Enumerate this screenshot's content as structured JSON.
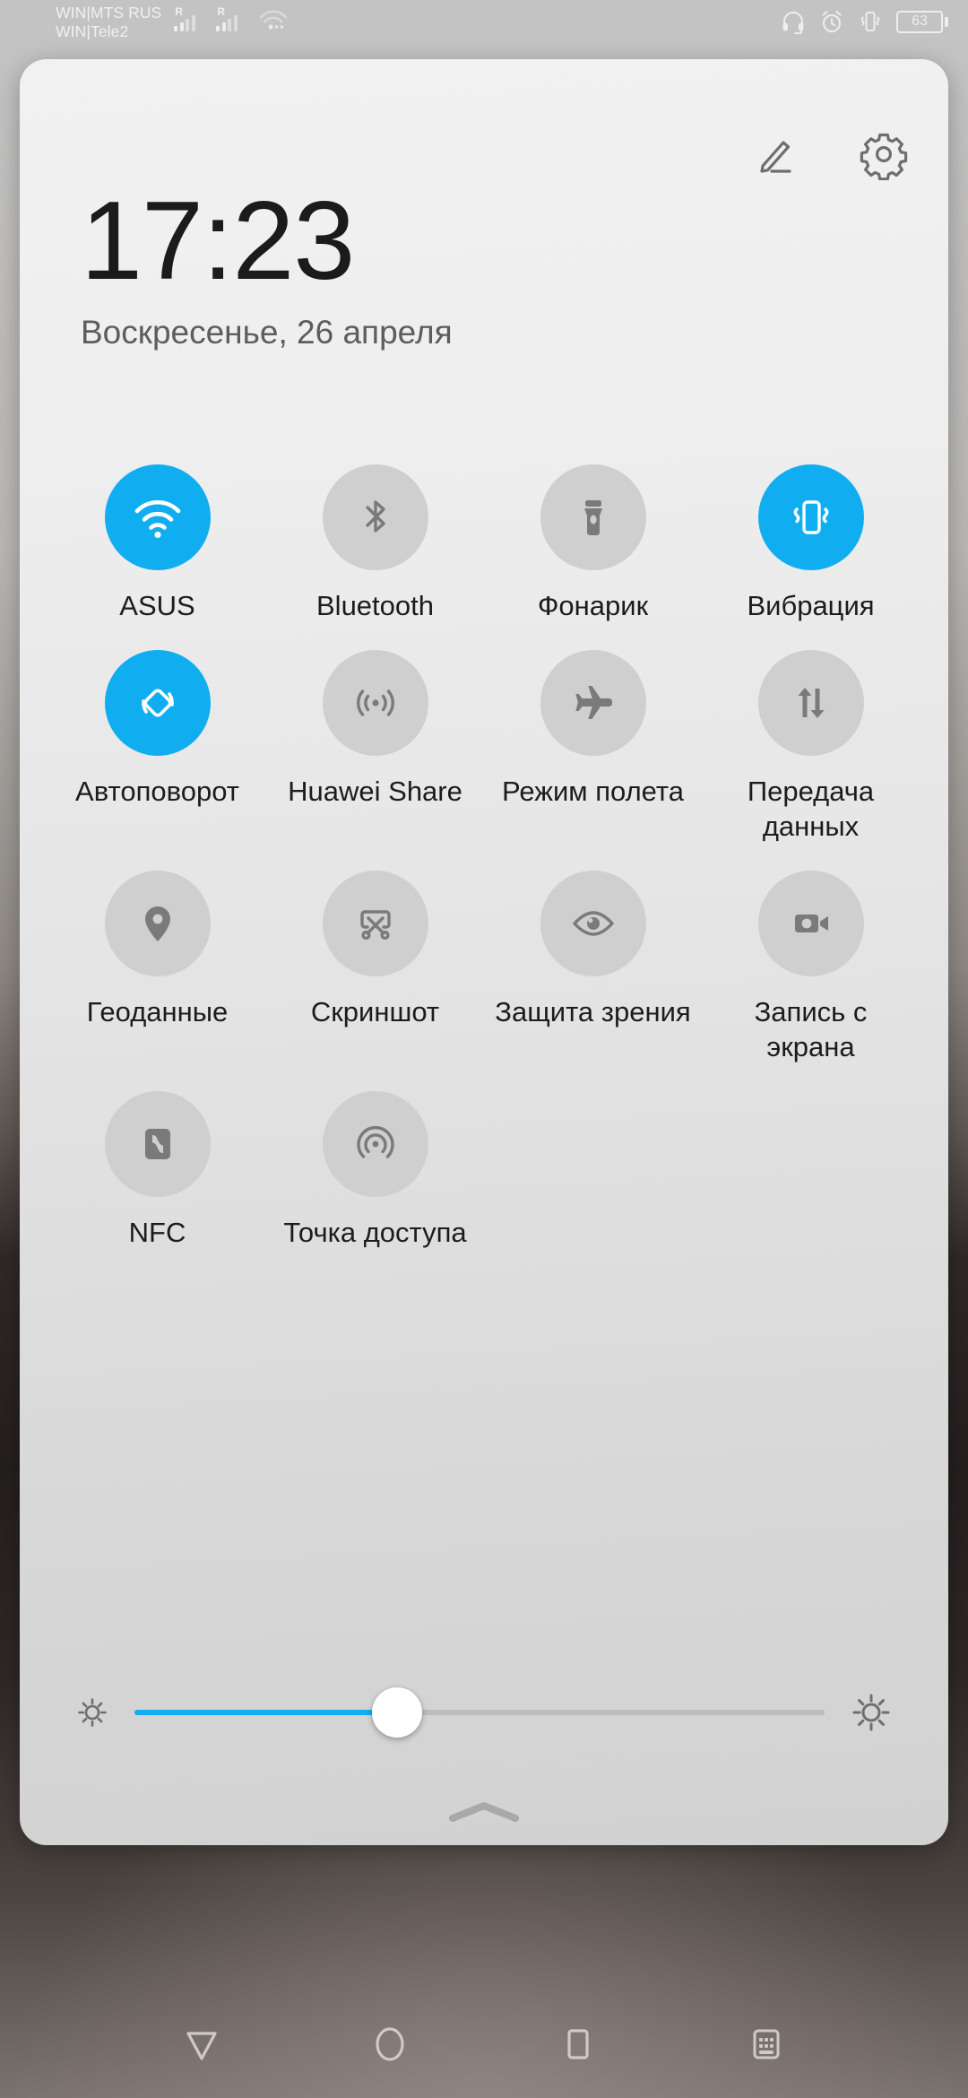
{
  "status_bar": {
    "carriers": [
      "WIN|MTS RUS",
      "WIN|Tele2"
    ],
    "sim1_roaming": "R",
    "sim2_roaming": "R",
    "icons": [
      "signal-sim1-icon",
      "signal-sim2-icon",
      "wifi-icon",
      "headphones-icon",
      "alarm-icon",
      "vibrate-icon"
    ],
    "battery_percent": "63"
  },
  "panel": {
    "edit_label": "edit-icon",
    "settings_label": "settings-icon",
    "time": "17:23",
    "date": "Воскресенье, 26 апреля",
    "collapse_label": "chevron-up-icon"
  },
  "tiles": [
    {
      "id": "wifi",
      "label": "ASUS",
      "icon": "wifi-icon",
      "active": true
    },
    {
      "id": "bluetooth",
      "label": "Bluetooth",
      "icon": "bluetooth-icon",
      "active": false
    },
    {
      "id": "flashlight",
      "label": "Фонарик",
      "icon": "flashlight-icon",
      "active": false
    },
    {
      "id": "vibration",
      "label": "Вибрация",
      "icon": "vibrate-icon",
      "active": true
    },
    {
      "id": "autorotate",
      "label": "Автоповорот",
      "icon": "auto-rotate-icon",
      "active": true
    },
    {
      "id": "huaweishare",
      "label": "Huawei Share",
      "icon": "huawei-share-icon",
      "active": false
    },
    {
      "id": "airplane",
      "label": "Режим полета",
      "icon": "airplane-icon",
      "active": false
    },
    {
      "id": "mobiledata",
      "label": "Передача данных",
      "icon": "data-transfer-icon",
      "active": false
    },
    {
      "id": "location",
      "label": "Геоданные",
      "icon": "location-pin-icon",
      "active": false
    },
    {
      "id": "screenshot",
      "label": "Скриншот",
      "icon": "scissors-icon",
      "active": false
    },
    {
      "id": "eyecomfort",
      "label": "Защита зрения",
      "icon": "eye-icon",
      "active": false
    },
    {
      "id": "screenrec",
      "label": "Запись с экрана",
      "icon": "video-camera-icon",
      "active": false
    },
    {
      "id": "nfc",
      "label": "NFC",
      "icon": "nfc-icon",
      "active": false
    },
    {
      "id": "hotspot",
      "label": "Точка доступа",
      "icon": "hotspot-icon",
      "active": false
    }
  ],
  "brightness": {
    "low_icon": "brightness-low-icon",
    "high_icon": "brightness-high-icon",
    "value_percent": 38
  },
  "nav_bar": {
    "items": [
      {
        "id": "back",
        "icon": "back-triangle-icon"
      },
      {
        "id": "home",
        "icon": "home-circle-icon"
      },
      {
        "id": "recents",
        "icon": "recents-square-icon"
      },
      {
        "id": "keyboard",
        "icon": "keyboard-icon"
      }
    ]
  },
  "colors": {
    "accent": "#10aef0",
    "tile_inactive": "#cfcfcf",
    "icon_gray": "#7a7a7a",
    "panel_bg": "#ececec"
  }
}
